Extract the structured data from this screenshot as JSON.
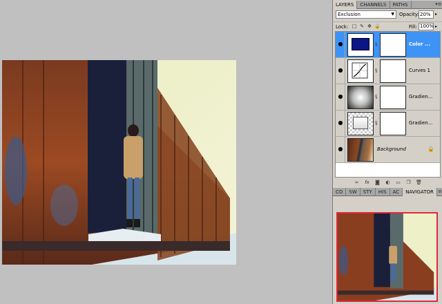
{
  "layers_panel": {
    "tabs": [
      "LAYERS",
      "CHANNELS",
      "PATHS"
    ],
    "blend_mode": "Exclusion",
    "opacity_label": "Opacity:",
    "opacity_value": "20%",
    "lock_label": "Lock:",
    "fill_label": "Fill:",
    "fill_value": "100%",
    "layers": [
      {
        "name": "Color ...",
        "thumb": "solid-color",
        "color": "#0a1688",
        "selected": true
      },
      {
        "name": "Curves 1",
        "thumb": "curves",
        "selected": false
      },
      {
        "name": "Gradien...",
        "thumb": "radial-gradient",
        "selected": false
      },
      {
        "name": "Gradien...",
        "thumb": "transparent",
        "selected": false
      },
      {
        "name": "Background",
        "thumb": "photo",
        "selected": false,
        "locked": true
      }
    ],
    "footer_icons": [
      "link-icon",
      "fx-icon",
      "mask-icon",
      "adjustment-icon",
      "folder-icon",
      "new-layer-icon",
      "trash-icon"
    ]
  },
  "lower_panel": {
    "tabs": [
      "CO",
      "SW",
      "STY",
      "HIS",
      "AC",
      "NAVIGATOR"
    ],
    "active_tab": "NAVIGATOR"
  },
  "colors": {
    "selection_blue": "#3d94f6",
    "navigator_frame": "#e0283c",
    "workspace_gray": "#c0c0c0"
  }
}
